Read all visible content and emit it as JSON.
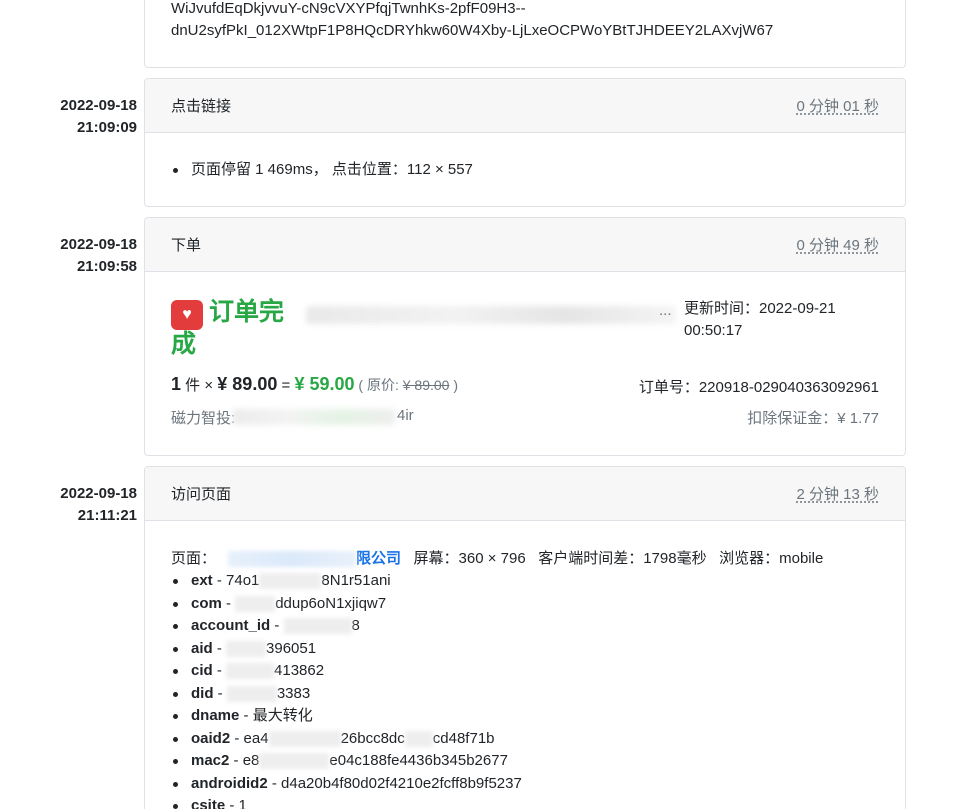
{
  "card0": {
    "line1": "WiJvufdEqDkjvvuY-cN9cVXYPfqjTwnhKs-2pfF09H3--",
    "line2": "dnU2syfPkI_012XWtpF1P8HQcDRYhkw60W4Xby-LjLxeOCPWoYBtTJHDEEY2LAXvjW67"
  },
  "events": [
    {
      "date": "2022-09-18",
      "time": "21:09:09",
      "title": "点击链接",
      "duration": "0 分钟 01 秒",
      "detail": "页面停留 1 469ms， 点击位置：112 × 557"
    },
    {
      "date": "2022-09-18",
      "time": "21:09:58",
      "title": "下单",
      "duration": "0 分钟 49 秒"
    },
    {
      "date": "2022-09-18",
      "time": "21:11:21",
      "title": "访问页面",
      "duration": "2 分钟 13 秒"
    }
  ],
  "order": {
    "icon_text": "♥",
    "status_title_1": "订单完",
    "status_title_2": "成",
    "title_suffix": "...",
    "update_label": "更新时间：2022-09-21",
    "update_time": "00:50:17",
    "qty": "1",
    "qty_unit": " 件 × ",
    "unit_price": "¥ 89.00",
    "equals": " = ",
    "paid_price": "¥ 59.00",
    "orig_prefix": " ( 原价: ",
    "orig_price": "¥ 89.00",
    "orig_suffix": " )",
    "order_no": "订单号：220918-029040363092961",
    "merchant_label": "磁力智投:",
    "merchant_suffix": "4ir",
    "deposit": "扣除保证金：¥ 1.77",
    "accent_color": "#28a745"
  },
  "visit": {
    "page_label": "页面：",
    "page_link_suffix": "限公司",
    "screen": "屏幕：360 × 796",
    "client_diff": "客户端时间差：1798毫秒",
    "browser": "浏览器：mobile",
    "params": [
      {
        "key": "ext",
        "v1": "74o1",
        "v2": "8N1r51ani"
      },
      {
        "key": "com",
        "v1": "",
        "v2": "ddup6oN1xjiqw7"
      },
      {
        "key": "account_id",
        "v1": "",
        "v2": "8"
      },
      {
        "key": "aid",
        "v1": "",
        "v2": "396051"
      },
      {
        "key": "cid",
        "v1": "",
        "v2": "413862"
      },
      {
        "key": "did",
        "v1": "",
        "v2": "3383"
      },
      {
        "key": "dname",
        "v1": "最大转化",
        "v2": ""
      },
      {
        "key": "oaid2",
        "v1": "ea4",
        "v2": "26bcc8dc",
        "v3": "cd48f71b"
      },
      {
        "key": "mac2",
        "v1": "e8",
        "v2": "e04c188fe4436b345b2677"
      },
      {
        "key": "androidid2",
        "v1": "d4a20b4f80d02f4210e2fcff8b9f5237",
        "v2": ""
      },
      {
        "key": "csite",
        "v1": "1",
        "v2": ""
      }
    ]
  }
}
